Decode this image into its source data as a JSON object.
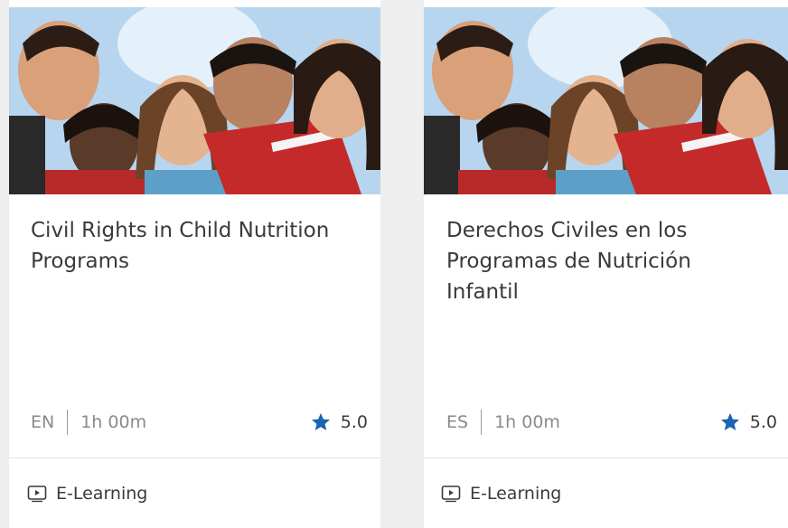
{
  "cards": [
    {
      "title": "Civil Rights in Child Nutrition Programs",
      "language": "EN",
      "duration": "1h 00m",
      "rating": "5.0",
      "type": "E-Learning"
    },
    {
      "title": "Derechos Civiles en los Programas de Nutrición Infantil",
      "language": "ES",
      "duration": "1h 00m",
      "rating": "5.0",
      "type": "E-Learning"
    }
  ],
  "icons": {
    "rating": "star-icon",
    "type": "video-play-icon"
  },
  "colors": {
    "star": "#1a64b4",
    "card_bg": "#ffffff",
    "page_bg": "#eeeeee"
  }
}
